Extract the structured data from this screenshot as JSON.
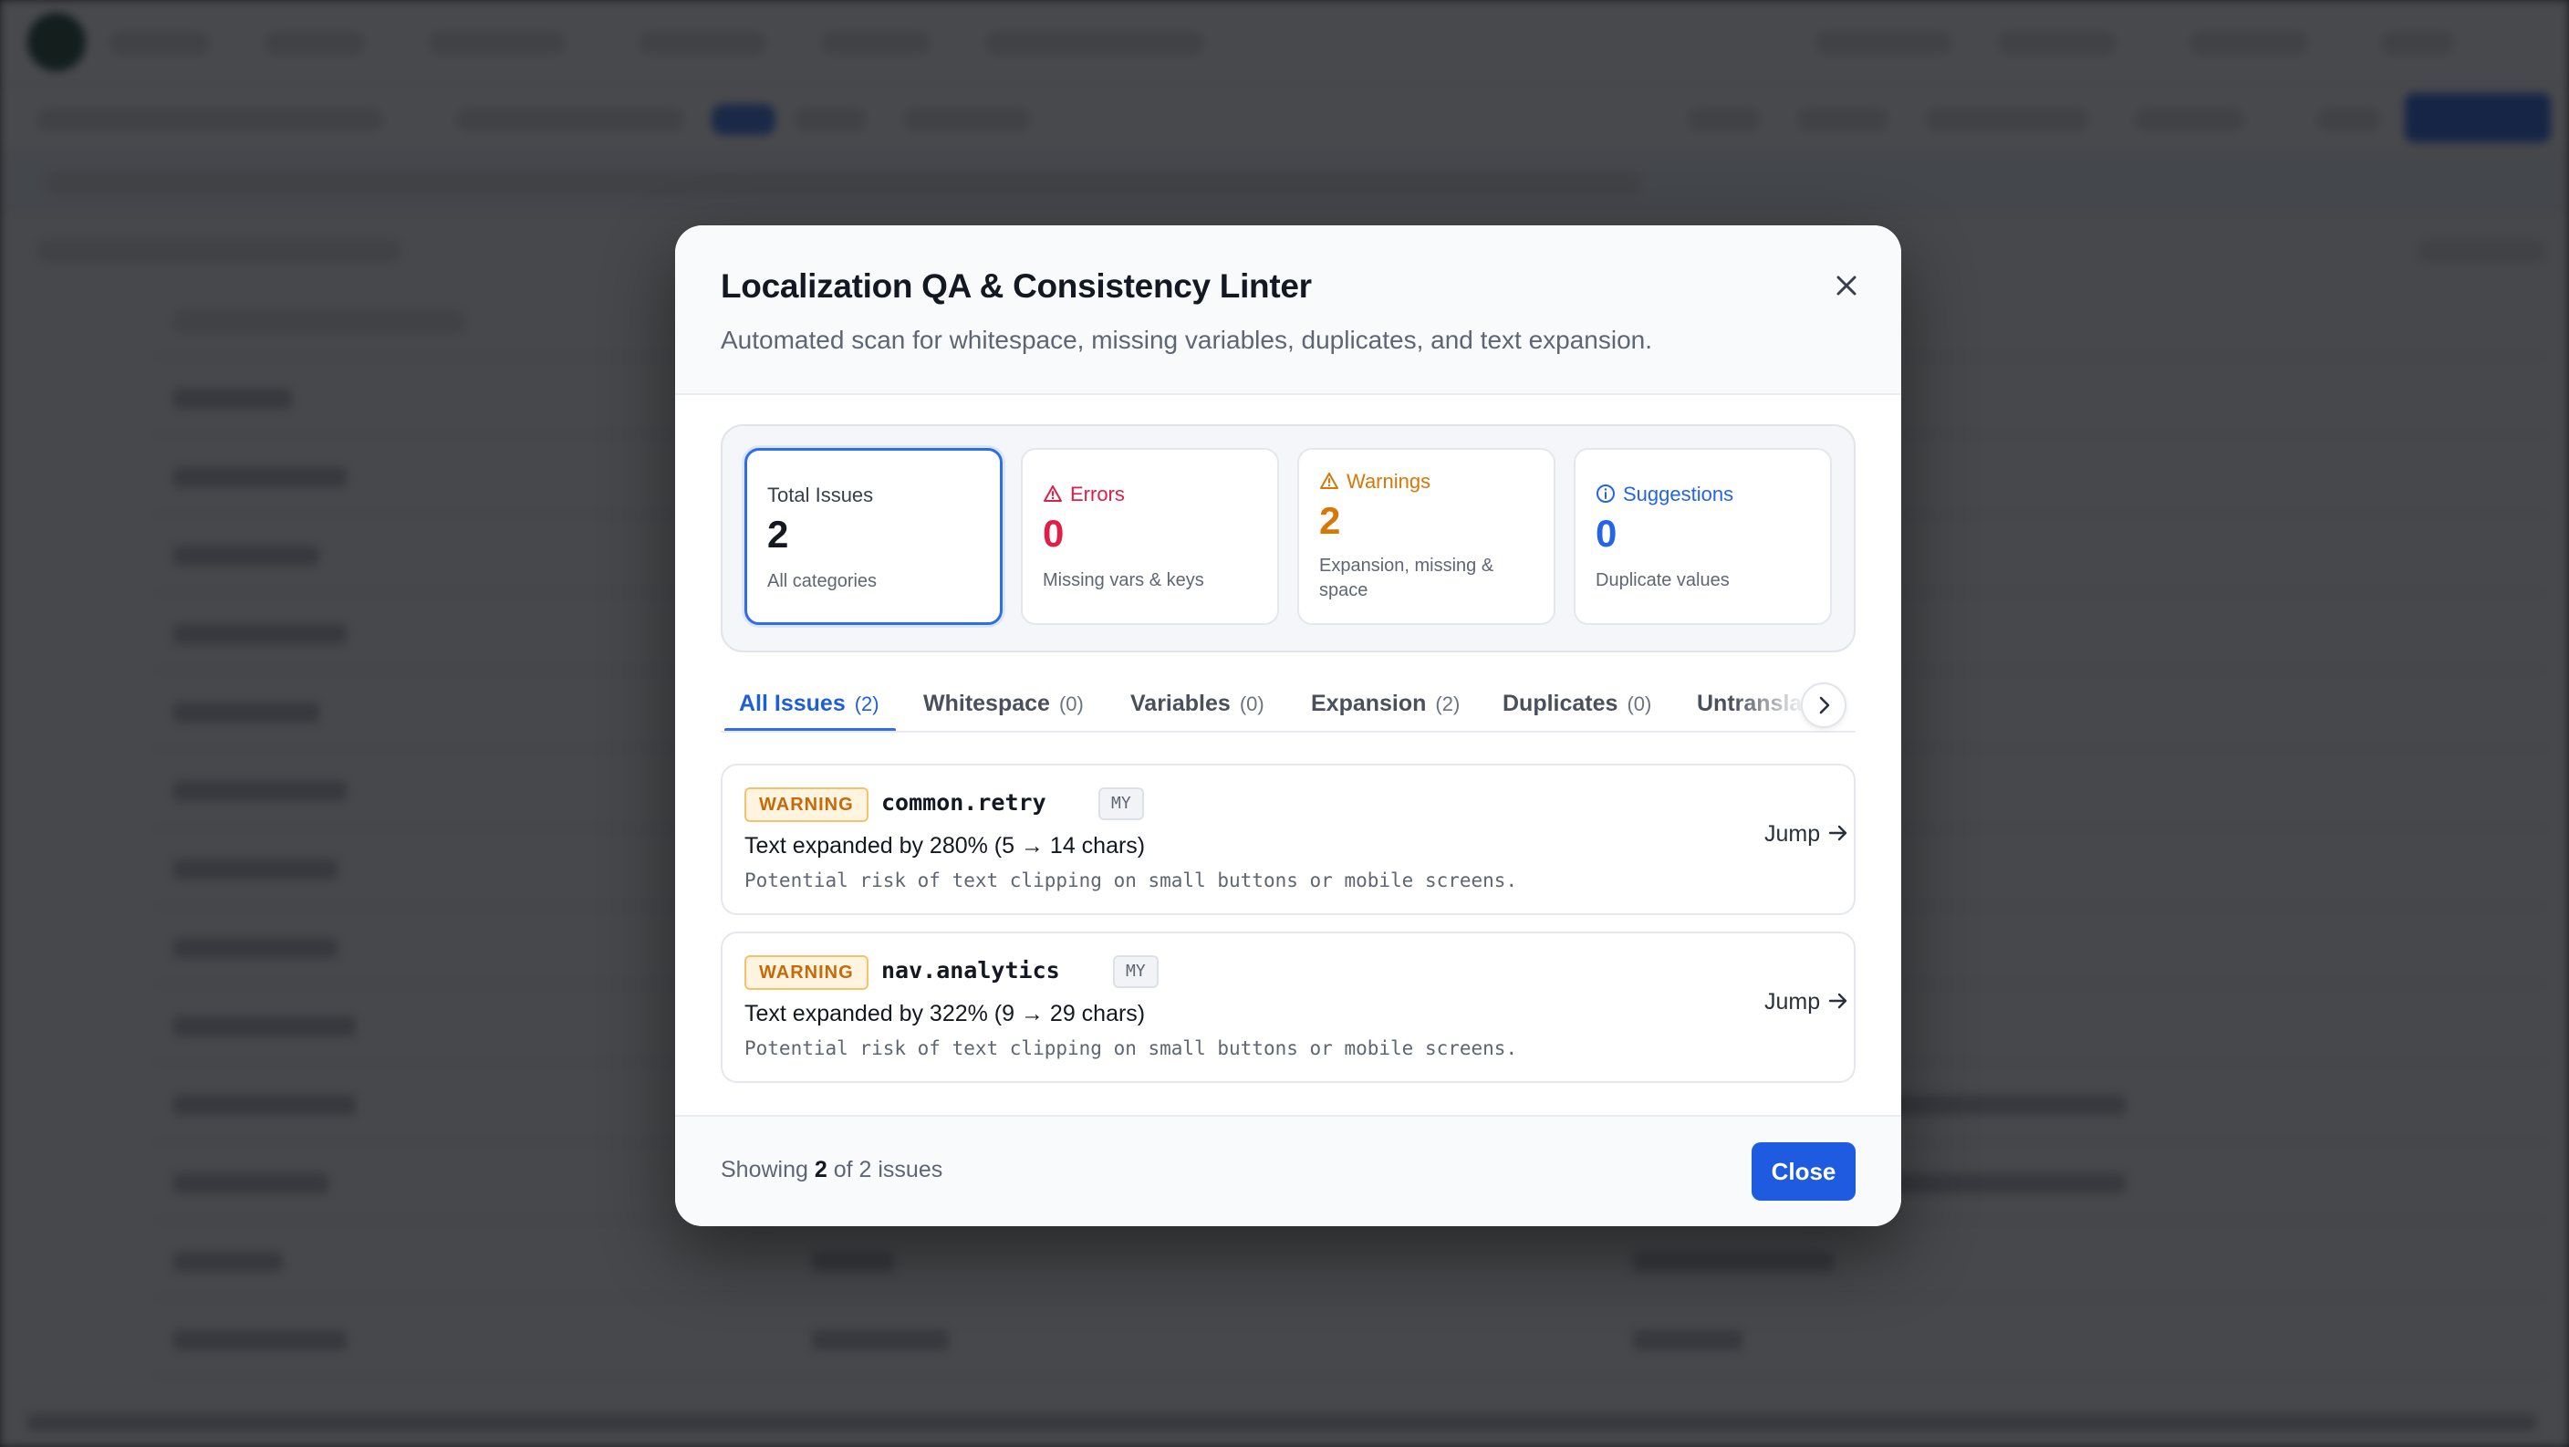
{
  "modal": {
    "title": "Localization QA & Consistency Linter",
    "subtitle": "Automated scan for whitespace, missing variables, duplicates, and text expansion.",
    "stats": {
      "total": {
        "label": "Total Issues",
        "value": "2",
        "sub": "All categories"
      },
      "errors": {
        "label": "Errors",
        "value": "0",
        "sub": "Missing vars & keys",
        "color": "#e11d48"
      },
      "warnings": {
        "label": "Warnings",
        "value": "2",
        "sub": "Expansion, missing & space",
        "color": "#d97706"
      },
      "suggestions": {
        "label": "Suggestions",
        "value": "0",
        "sub": "Duplicate values",
        "color": "#2563eb"
      }
    },
    "tabs": [
      {
        "label": "All Issues",
        "count": "(2)"
      },
      {
        "label": "Whitespace",
        "count": "(0)"
      },
      {
        "label": "Variables",
        "count": "(0)"
      },
      {
        "label": "Expansion",
        "count": "(2)"
      },
      {
        "label": "Duplicates",
        "count": "(0)"
      },
      {
        "label": "Untranslated",
        "count": ""
      }
    ],
    "issues": [
      {
        "severity": "WARNING",
        "key": "common.retry",
        "lang": "MY",
        "message": "Text expanded by 280% (5 → 14 chars)",
        "hint": "Potential risk of text clipping on small buttons or mobile screens.",
        "action": "Jump"
      },
      {
        "severity": "WARNING",
        "key": "nav.analytics",
        "lang": "MY",
        "message": "Text expanded by 322% (9 → 29 chars)",
        "hint": "Potential risk of text clipping on small buttons or mobile screens.",
        "action": "Jump"
      }
    ],
    "footer": {
      "prefix": "Showing",
      "shown": "2",
      "suffix": "of 2 issues",
      "close_label": "Close"
    }
  },
  "colors": {
    "accent": "#1e5be0",
    "warning": "#d97706",
    "error": "#e11d48",
    "info": "#2563eb"
  }
}
